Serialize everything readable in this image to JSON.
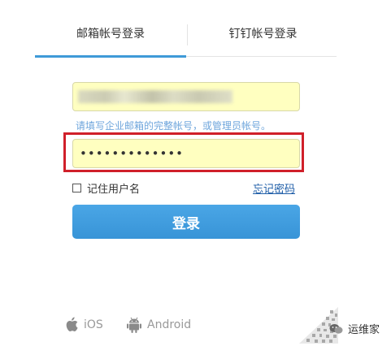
{
  "tabs": [
    {
      "label": "邮箱帐号登录",
      "active": true
    },
    {
      "label": "钉钉帐号登录",
      "active": false
    }
  ],
  "form": {
    "account_value": "",
    "hint": "请填写企业邮箱的完整帐号，或管理员帐号。",
    "password_value": "•••••••••••••",
    "remember_label": "记住用户名",
    "forgot_label": "忘记密码",
    "login_label": "登录"
  },
  "apps": [
    {
      "label": "iOS",
      "icon": "apple-icon"
    },
    {
      "label": "Android",
      "icon": "android-icon"
    }
  ],
  "watermark": {
    "label": "运维家"
  },
  "colors": {
    "accent": "#3f9ad8",
    "input_bg": "#ffffc0",
    "highlight": "#d0202a",
    "hint": "#6fa6dc",
    "link": "#1f5ea8"
  }
}
